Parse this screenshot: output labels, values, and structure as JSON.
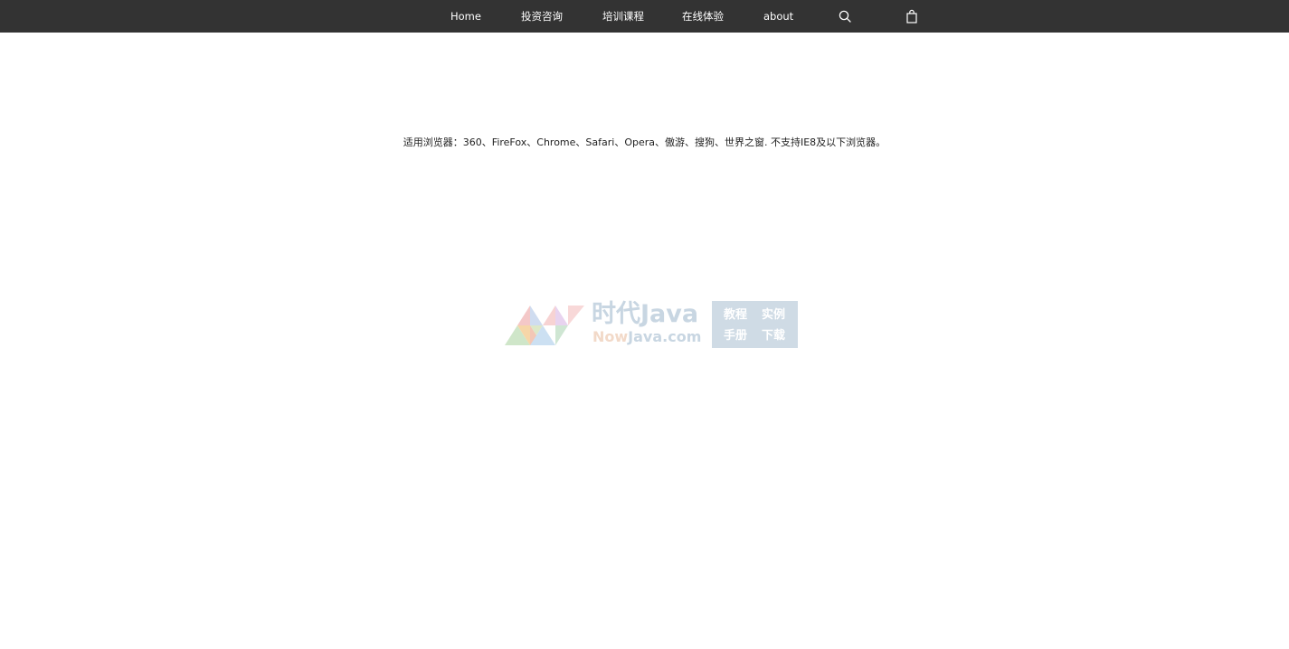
{
  "nav": {
    "items": [
      {
        "label": "Home"
      },
      {
        "label": "投资咨询"
      },
      {
        "label": "培训课程"
      },
      {
        "label": "在线体验"
      },
      {
        "label": "about"
      }
    ],
    "icons": [
      "search-icon",
      "shopping-bag-icon"
    ]
  },
  "notice": {
    "text": "适用浏览器：360、FireFox、Chrome、Safari、Opera、傲游、搜狗、世界之窗. 不支持IE8及以下浏览器。"
  },
  "watermark": {
    "title": "时代Java",
    "subtitle_a": "Now",
    "subtitle_b": "Java.com",
    "box": [
      "教程",
      "实例",
      "手册",
      "下载"
    ]
  },
  "colors": {
    "nav_bg": "#333333",
    "nav_text": "#ffffff",
    "watermark_blue": "#c8d6e2",
    "watermark_orange": "#f2d9c8"
  }
}
